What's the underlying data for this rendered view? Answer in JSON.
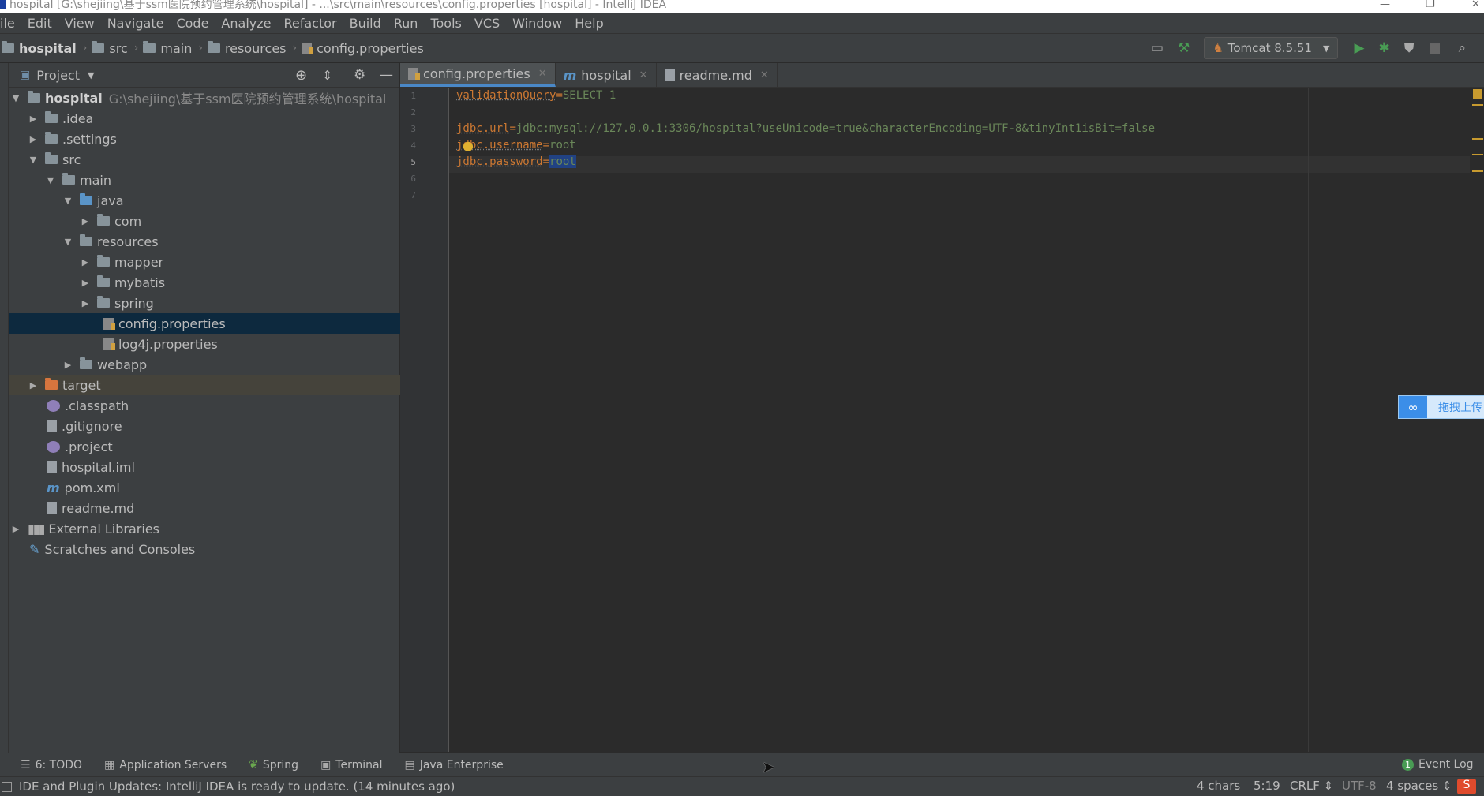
{
  "window": {
    "title": "hospital [G:\\shejiing\\基于ssm医院预约管理系统\\hospital] - ...\\src\\main\\resources\\config.properties [hospital] - IntelliJ IDEA"
  },
  "menu": [
    "ile",
    "Edit",
    "View",
    "Navigate",
    "Code",
    "Analyze",
    "Refactor",
    "Build",
    "Run",
    "Tools",
    "VCS",
    "Window",
    "Help"
  ],
  "breadcrumbs": [
    "hospital",
    "src",
    "main",
    "resources",
    "config.properties"
  ],
  "run_config": "Tomcat 8.5.51",
  "project_panel": {
    "title": "Project",
    "root_name": "hospital",
    "root_path": "G:\\shejiing\\基于ssm医院预约管理系统\\hospital",
    "items": [
      ".idea",
      ".settings",
      "src",
      "main",
      "java",
      "com",
      "resources",
      "mapper",
      "mybatis",
      "spring",
      "config.properties",
      "log4j.properties",
      "webapp",
      "target",
      ".classpath",
      ".gitignore",
      ".project",
      "hospital.iml",
      "pom.xml",
      "readme.md",
      "External Libraries",
      "Scratches and Consoles"
    ]
  },
  "tabs": [
    {
      "label": "config.properties"
    },
    {
      "label": "hospital"
    },
    {
      "label": "readme.md"
    }
  ],
  "editor": {
    "line_numbers": [
      "1",
      "2",
      "3",
      "4",
      "5",
      "6",
      "7"
    ],
    "lines": [
      {
        "key": "validationQuery",
        "value": "SELECT 1"
      },
      {
        "key": "jdbc.url",
        "value": "jdbc:mysql://127.0.0.1:3306/hospital?useUnicode=true&characterEncoding=UTF-8&tinyInt1isBit=false"
      },
      {
        "key": "jdbc.username",
        "value": "root"
      },
      {
        "key": "jdbc.password",
        "value": "root"
      }
    ]
  },
  "upload_widget": {
    "label": "拖拽上传"
  },
  "bottom_tools": [
    "6: TODO",
    "Application Servers",
    "Spring",
    "Terminal",
    "Java Enterprise"
  ],
  "event_log": {
    "badge": "1",
    "label": "Event Log"
  },
  "status": {
    "message": "IDE and Plugin Updates: IntelliJ IDEA is ready to update. (14 minutes ago)",
    "chars": "4 chars",
    "position": "5:19",
    "line_sep": "CRLF",
    "encoding": "UTF-8",
    "indent": "4 spaces"
  },
  "colors": {
    "accent": "#4a88c7",
    "keyword": "#cc7832",
    "string": "#6a8759",
    "selection": "#214283"
  }
}
